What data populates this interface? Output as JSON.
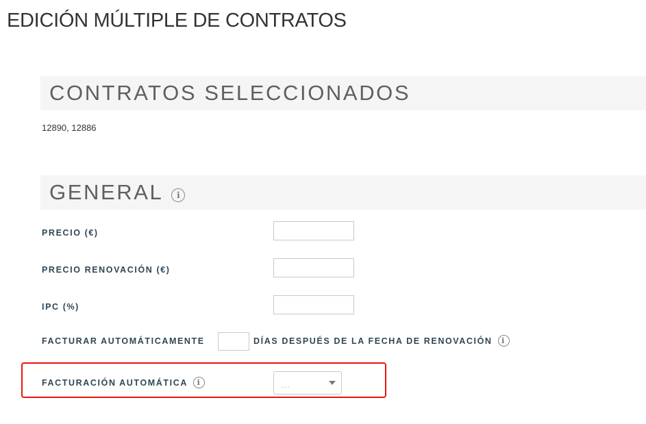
{
  "page": {
    "title": "EDICIÓN MÚLTIPLE DE CONTRATOS"
  },
  "selected_contracts": {
    "heading": "CONTRATOS SELECCIONADOS",
    "ids_text": "12890, 12886"
  },
  "general": {
    "heading": "GENERAL",
    "info_icon": "info-circle-icon",
    "fields": {
      "precio": {
        "label": "PRECIO (€)",
        "value": ""
      },
      "precio_renovacion": {
        "label": "PRECIO RENOVACIÓN (€)",
        "value": ""
      },
      "ipc": {
        "label": "IPC (%)",
        "value": ""
      },
      "facturar_auto": {
        "label_before": "FACTURAR AUTOMÁTICAMENTE",
        "label_after": "DÍAS DESPUÉS DE LA FECHA DE RENOVACIÓN",
        "value": ""
      },
      "facturacion_automatica": {
        "label": "FACTURACIÓN AUTOMÁTICA",
        "selected": "..."
      }
    }
  },
  "colors": {
    "highlight": "#e8140f",
    "label": "#2f4656",
    "section_bg": "#f5f5f5"
  }
}
